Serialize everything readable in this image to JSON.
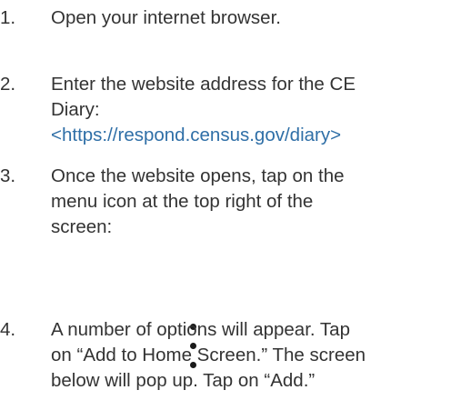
{
  "steps": [
    {
      "number": "1.",
      "lines": [
        "Open your internet browser."
      ]
    },
    {
      "number": "2.",
      "lines": [
        "Enter the website address for the CE",
        "Diary:"
      ],
      "link": "<https://respond.census.gov/diary>"
    },
    {
      "number": "3.",
      "lines": [
        "Once the website opens, tap on the",
        "menu icon at the top right of the",
        "screen:"
      ]
    },
    {
      "number": "4.",
      "lines": [
        "A number of options will appear. Tap",
        "on “Add to Home Screen.” The screen",
        "below will pop up. Tap on “Add.”"
      ]
    }
  ],
  "menu_icon": "vertical-ellipsis-icon",
  "colors": {
    "text": "#333333",
    "link": "#2f6fa7",
    "icon": "#1a1a1a"
  }
}
